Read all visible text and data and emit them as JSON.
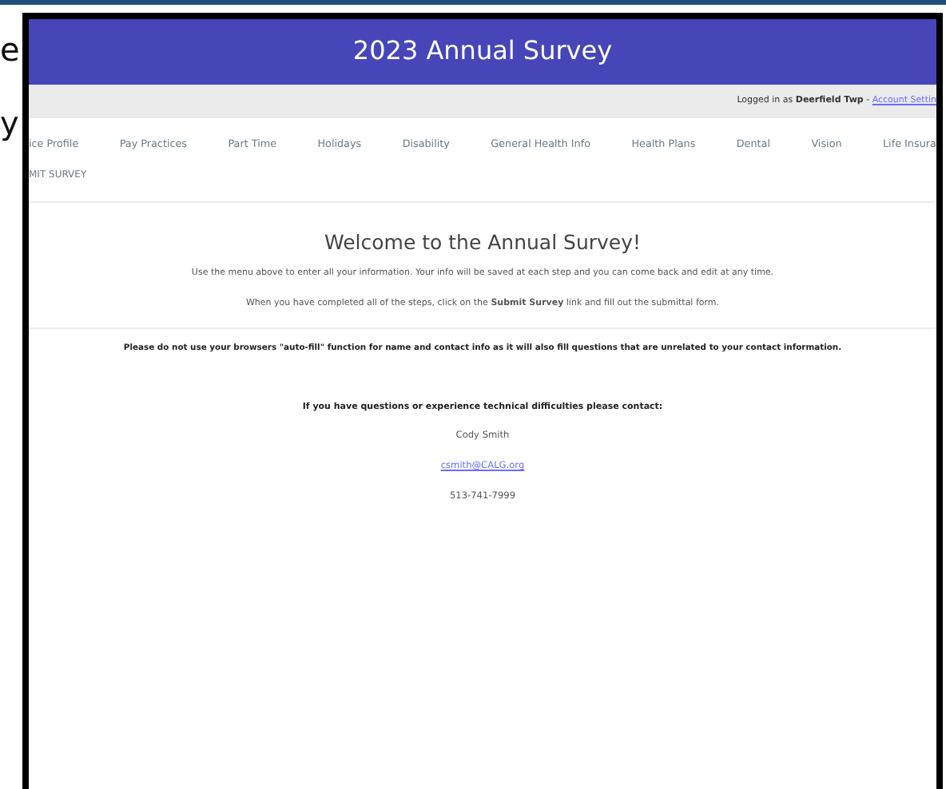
{
  "slide_fragments": [
    "e",
    "y"
  ],
  "header": {
    "title": "2023 Annual Survey"
  },
  "account_bar": {
    "logged_in": "Logged in as **Deerfield Twp** -",
    "link": "Account Settin"
  },
  "nav": {
    "items": [
      {
        "label": "ice Profile"
      },
      {
        "label": "Pay Practices"
      },
      {
        "label": "Part Time"
      },
      {
        "label": "Holidays"
      },
      {
        "label": "Disability"
      },
      {
        "label": "General Health Info"
      },
      {
        "label": "Health Plans"
      },
      {
        "label": "Dental"
      },
      {
        "label": "Vision"
      },
      {
        "label": "Life Insura"
      }
    ],
    "second_row": "MIT SURVEY"
  },
  "welcome": {
    "heading": "Welcome to the Annual Survey!",
    "lines": [
      "Use the menu above to enter all your information. Your info will be saved at each step and you can come back and edit at any time.",
      "When you have completed all of the steps, click on the **Submit Survey** link and fill out the submittal form."
    ]
  },
  "warning": "Please do not use your browsers \"auto-fill\" function for name and contact info as it will also fill questions that are unrelated to your contact information.",
  "contact": {
    "heading": "If you have questions or experience technical difficulties please contact:",
    "name": "Cody Smith",
    "email": "csmith@CALG.org",
    "phone": "513-741-7999"
  }
}
